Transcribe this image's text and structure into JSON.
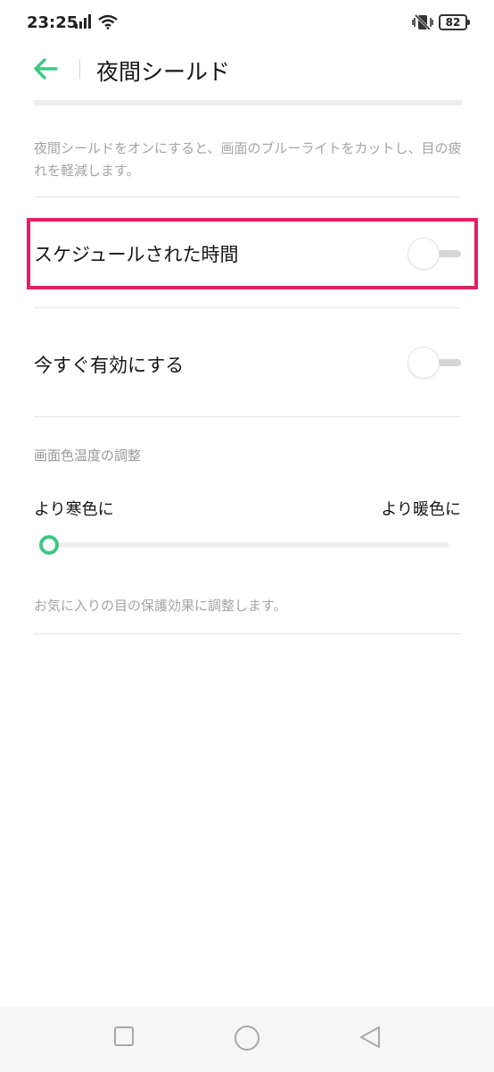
{
  "status": {
    "time": "23:25",
    "battery": "82",
    "icons": [
      "signal-icon",
      "wifi-icon",
      "vibrate-off-icon",
      "battery-icon"
    ]
  },
  "header": {
    "title": "夜間シールド",
    "back_icon": "arrow-left-icon"
  },
  "description": "夜間シールドをオンにすると、画面のブルーライトをカットし、目の疲れを軽減します。",
  "settings": [
    {
      "label": "スケジュールされた時間",
      "enabled": false
    },
    {
      "label": "今すぐ有効にする",
      "enabled": false
    }
  ],
  "color_temperature": {
    "section_title": "画面色温度の調整",
    "cool_label": "より寒色に",
    "warm_label": "より暖色に",
    "value": 0.0,
    "footnote": "お気に入りの目の保護効果に調整します。"
  },
  "nav": {
    "icons": [
      "recent-apps-icon",
      "home-icon",
      "back-icon"
    ]
  },
  "colors": {
    "accent": "#3dc785",
    "highlight": "#e02063"
  }
}
